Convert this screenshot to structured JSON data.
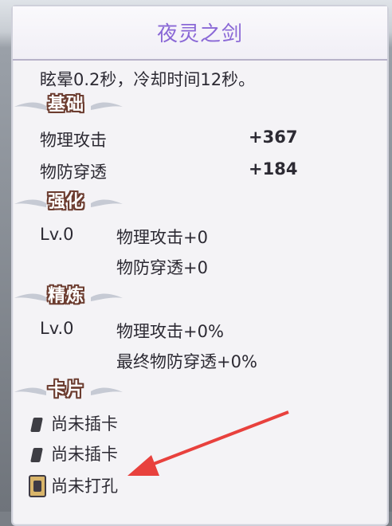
{
  "item": {
    "title": "夜灵之剑",
    "description": "眩晕0.2秒，冷却时间12秒。"
  },
  "sections": {
    "base": {
      "label": "基础",
      "stats": [
        {
          "name": "物理攻击",
          "value": "+367"
        },
        {
          "name": "物防穿透",
          "value": "+184"
        }
      ]
    },
    "enhance": {
      "label": "强化",
      "level": "Lv.0",
      "stats": [
        "物理攻击+0",
        "物防穿透+0"
      ]
    },
    "refine": {
      "label": "精炼",
      "level": "Lv.0",
      "stats": [
        "物理攻击+0%",
        "最终物防穿透+0%"
      ]
    },
    "cards": {
      "label": "卡片",
      "slots": [
        "尚未插卡",
        "尚未插卡",
        "尚未打孔"
      ]
    }
  },
  "colors": {
    "title": "#8a68d6",
    "badge_outline": "#6b3b2e",
    "arrow": "#e8413d",
    "text": "#2c2a33"
  },
  "icons": [
    "card-slot-icon",
    "card-slot-icon",
    "unpunched-hole-icon",
    "wing-ornament-icon"
  ]
}
